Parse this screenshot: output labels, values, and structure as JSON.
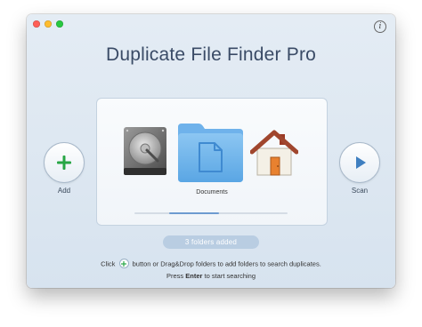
{
  "window": {
    "title": "Duplicate File Finder Pro",
    "info_icon": "i"
  },
  "add": {
    "label": "Add",
    "icon": "plus-icon",
    "color": "#27a645"
  },
  "scan": {
    "label": "Scan",
    "icon": "play-icon",
    "color": "#3f7fc0"
  },
  "drop_area": {
    "items": [
      {
        "icon": "hard-drive-icon"
      },
      {
        "icon": "documents-folder-icon",
        "label": "Documents"
      },
      {
        "icon": "home-folder-icon"
      }
    ],
    "scroll_position": 0.34
  },
  "status": {
    "text": "3 folders added"
  },
  "hint": {
    "line1_before": "Click",
    "line1_after": "button or Drag&Drop folders to add folders to search duplicates.",
    "line2_before": "Press",
    "line2_key": "Enter",
    "line2_after": "to start searching"
  }
}
